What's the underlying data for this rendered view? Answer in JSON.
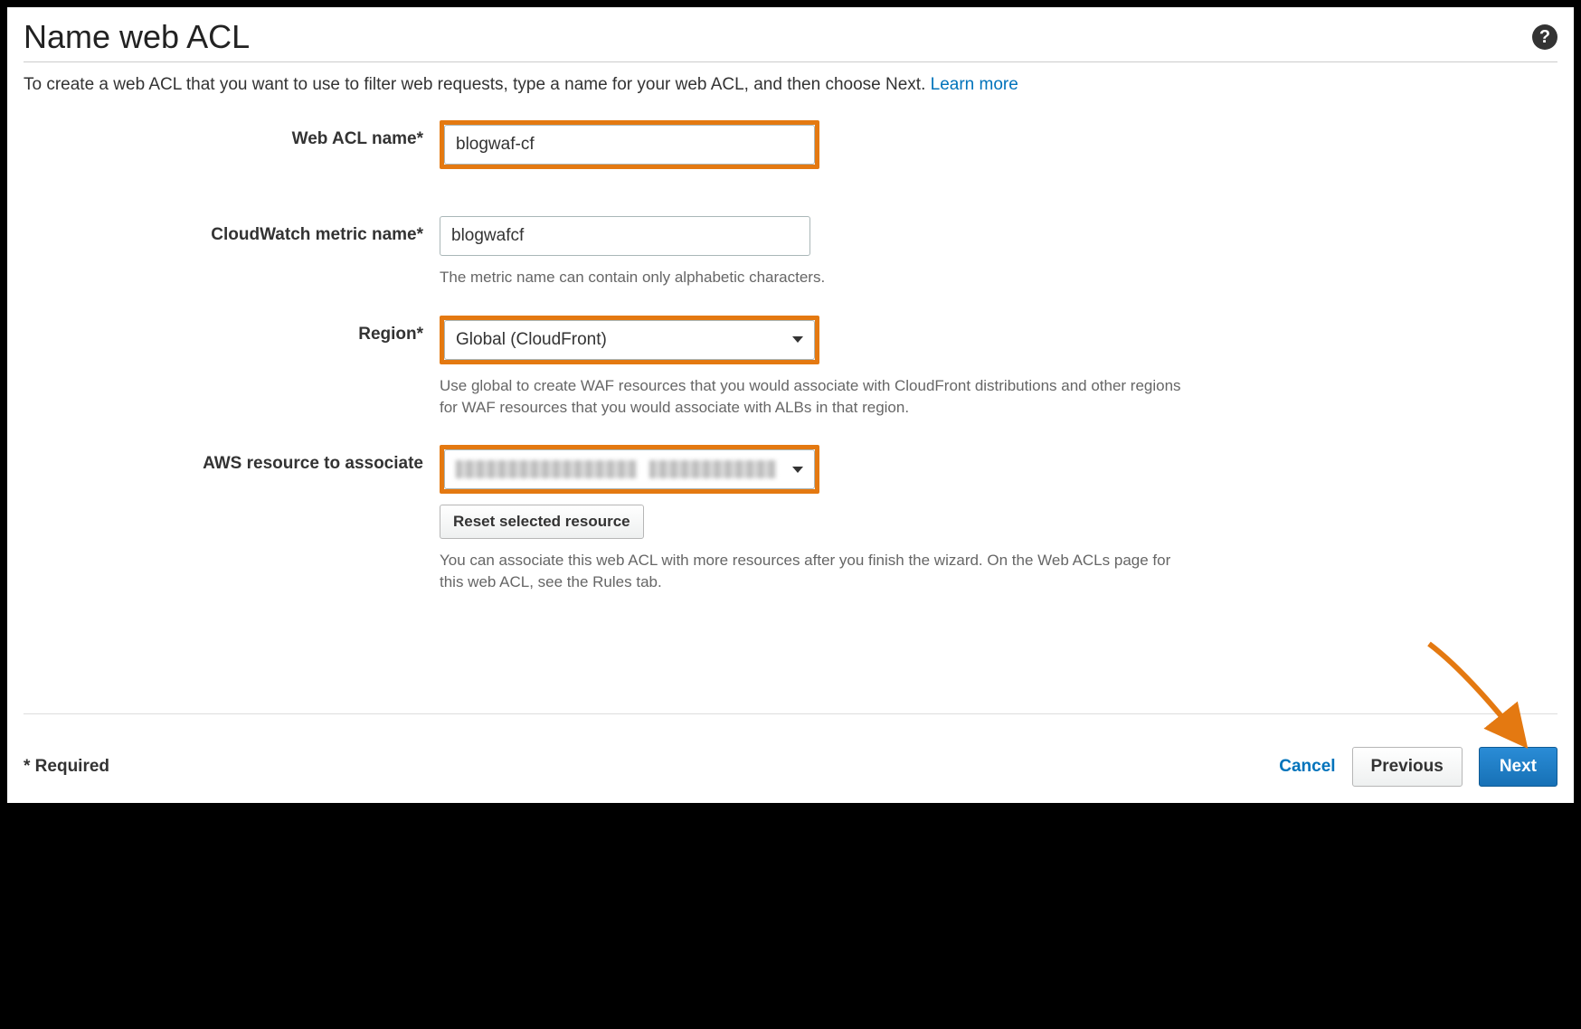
{
  "header": {
    "title": "Name web ACL"
  },
  "intro": {
    "text": "To create a web ACL that you want to use to filter web requests, type a name for your web ACL, and then choose Next. ",
    "link_label": "Learn more"
  },
  "form": {
    "web_acl_name": {
      "label": "Web ACL name*",
      "value": "blogwaf-cf"
    },
    "metric_name": {
      "label": "CloudWatch metric name*",
      "value": "blogwafcf",
      "help": "The metric name can contain only alphabetic characters."
    },
    "region": {
      "label": "Region*",
      "selected": "Global (CloudFront)",
      "help": "Use global to create WAF resources that you would associate with CloudFront distributions and other regions for WAF resources that you would associate with ALBs in that region."
    },
    "resource": {
      "label": "AWS resource to associate",
      "reset_label": "Reset selected resource",
      "help": "You can associate this web ACL with more resources after you finish the wizard. On the Web ACLs page for this web ACL, see the Rules tab."
    }
  },
  "footer": {
    "required_note": "* Required",
    "cancel": "Cancel",
    "previous": "Previous",
    "next": "Next"
  }
}
